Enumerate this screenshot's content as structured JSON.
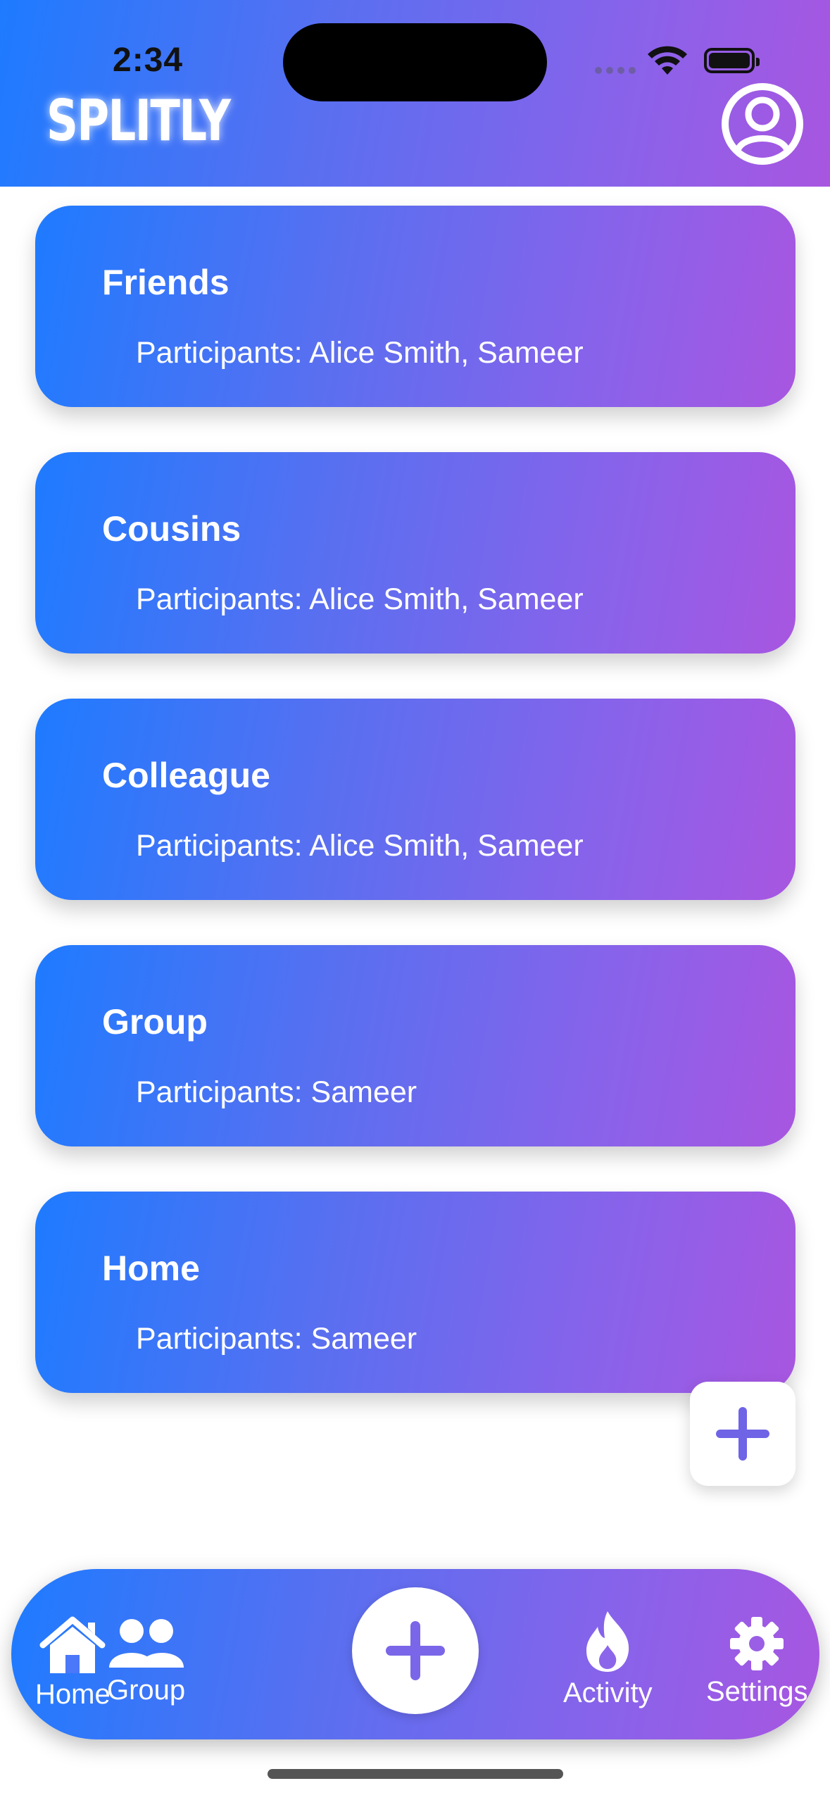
{
  "status_bar": {
    "time": "2:34"
  },
  "header": {
    "app_title": "SPLITLY"
  },
  "groups": [
    {
      "name": "Friends",
      "participants": "Participants: Alice Smith, Sameer"
    },
    {
      "name": "Cousins",
      "participants": "Participants: Alice Smith, Sameer"
    },
    {
      "name": "Colleague",
      "participants": "Participants: Alice Smith, Sameer"
    },
    {
      "name": "Group",
      "participants": "Participants: Sameer"
    },
    {
      "name": "Home",
      "participants": "Participants: Sameer"
    }
  ],
  "tabbar": {
    "home": "Home",
    "group": "Group",
    "activity": "Activity",
    "settings": "Settings"
  },
  "icons": {
    "profile": "person-circle-icon",
    "fab": "plus-icon",
    "center": "plus-icon",
    "home": "house-icon",
    "group": "people-icon",
    "activity": "flame-icon",
    "settings": "gear-icon"
  },
  "colors": {
    "gradient_start": "#1e7bff",
    "gradient_end": "#a856e0",
    "accent": "#6f64e6"
  }
}
